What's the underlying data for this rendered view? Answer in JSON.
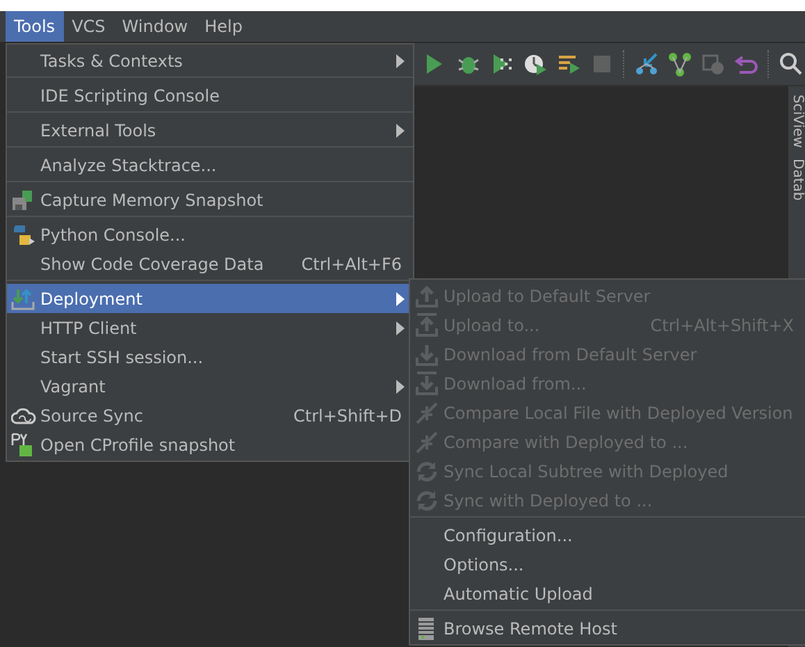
{
  "menubar": [
    {
      "label": "Tools",
      "selected": true
    },
    {
      "label": "VCS",
      "selected": false
    },
    {
      "label": "Window",
      "selected": false
    },
    {
      "label": "Help",
      "selected": false
    }
  ],
  "side_tabs": [
    "SciView",
    "Datab"
  ],
  "tools_menu": {
    "items": [
      {
        "kind": "item",
        "label": "Tasks & Contexts",
        "submenu": true,
        "selected": false
      },
      {
        "kind": "separator"
      },
      {
        "kind": "item",
        "label": "IDE Scripting Console",
        "submenu": false,
        "selected": false
      },
      {
        "kind": "separator"
      },
      {
        "kind": "item",
        "label": "External Tools",
        "submenu": true,
        "selected": false
      },
      {
        "kind": "separator"
      },
      {
        "kind": "item",
        "label": "Analyze Stacktrace...",
        "submenu": false,
        "selected": false
      },
      {
        "kind": "separator"
      },
      {
        "kind": "item",
        "label": "Capture Memory Snapshot",
        "submenu": false,
        "selected": false
      },
      {
        "kind": "separator"
      },
      {
        "kind": "item",
        "label": "Python Console...",
        "submenu": false,
        "selected": false
      },
      {
        "kind": "item",
        "label": "Show Code Coverage Data",
        "shortcut": "Ctrl+Alt+F6",
        "submenu": false,
        "selected": false
      },
      {
        "kind": "separator"
      },
      {
        "kind": "item",
        "label": "Deployment",
        "submenu": true,
        "selected": true
      },
      {
        "kind": "item",
        "label": "HTTP Client",
        "submenu": true,
        "selected": false
      },
      {
        "kind": "item",
        "label": "Start SSH session...",
        "submenu": false,
        "selected": false
      },
      {
        "kind": "item",
        "label": "Vagrant",
        "submenu": true,
        "selected": false
      },
      {
        "kind": "item",
        "label": "Source Sync",
        "shortcut": "Ctrl+Shift+D",
        "submenu": false,
        "selected": false
      },
      {
        "kind": "item",
        "label": "Open CProfile snapshot",
        "submenu": false,
        "selected": false
      }
    ]
  },
  "deployment_submenu": {
    "items": [
      {
        "kind": "item",
        "label": "Upload to Default Server",
        "disabled": true
      },
      {
        "kind": "item",
        "label": "Upload to...",
        "shortcut": "Ctrl+Alt+Shift+X",
        "disabled": true
      },
      {
        "kind": "item",
        "label": "Download from Default Server",
        "disabled": true
      },
      {
        "kind": "item",
        "label": "Download from...",
        "disabled": true
      },
      {
        "kind": "item",
        "label": "Compare Local File with Deployed Version",
        "disabled": true
      },
      {
        "kind": "item",
        "label": "Compare with Deployed to ...",
        "disabled": true
      },
      {
        "kind": "item",
        "label": "Sync Local Subtree with Deployed",
        "disabled": true
      },
      {
        "kind": "item",
        "label": "Sync with Deployed to ...",
        "disabled": true
      },
      {
        "kind": "separator"
      },
      {
        "kind": "item",
        "label": "Configuration...",
        "disabled": false
      },
      {
        "kind": "item",
        "label": "Options...",
        "disabled": false
      },
      {
        "kind": "item",
        "label": "Automatic Upload",
        "disabled": false
      },
      {
        "kind": "separator"
      },
      {
        "kind": "item",
        "label": "Browse Remote Host",
        "disabled": false
      }
    ]
  }
}
